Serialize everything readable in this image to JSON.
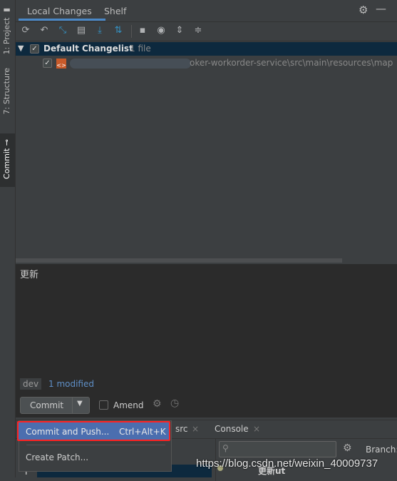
{
  "sidebar": {
    "project": "1: Project",
    "structure": "7: Structure",
    "commit": "Commit"
  },
  "tabs": {
    "local_changes": "Local Changes",
    "shelf": "Shelf"
  },
  "changelist": {
    "name": "Default Changelist",
    "count": "1 file",
    "file_path": "oker-workorder-service\\src\\main\\resources\\map"
  },
  "message": {
    "text": "更新"
  },
  "status": {
    "branch": "dev",
    "modified": "1 modified"
  },
  "actions": {
    "commit": "Commit",
    "amend": "Amend"
  },
  "popup": {
    "commit_push": "Commit and Push...",
    "commit_push_shortcut": "Ctrl+Alt+K",
    "create_patch": "Create Patch..."
  },
  "bottom": {
    "tab_src": "src",
    "tab_console": "Console",
    "branch_label": "Branch:",
    "commit_row": "更新ut",
    "watermark": "https://blog.csdn.net/weixin_40009737"
  },
  "colors": {
    "accent": "#3592c4",
    "selection": "#0d293e",
    "highlight": "#4b6eaf",
    "red_outline": "#ff2222"
  }
}
